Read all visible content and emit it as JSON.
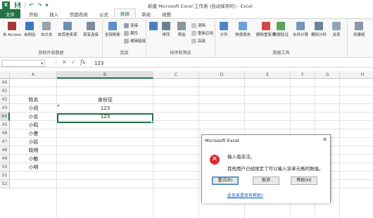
{
  "app": {
    "logo": "X",
    "title": "新建 Microsoft Excel 工作表 (自动保存的) - Excel"
  },
  "tabs": [
    "文件",
    "开始",
    "插入",
    "页面布局",
    "公式",
    "数据",
    "审阅",
    "视图"
  ],
  "active_tab": "数据",
  "ribbon": {
    "get_external": {
      "label": "获取外部数据",
      "buttons": [
        "自 Access",
        "自网站",
        "自文本",
        "自其他来源",
        "现有连接"
      ]
    },
    "connections": {
      "label": "连接",
      "big": "全部刷新",
      "small": [
        "连接",
        "属性",
        "编辑链接"
      ]
    },
    "sort_filter": {
      "label": "排序和筛选",
      "buttons": [
        "排序",
        "筛选"
      ],
      "small": [
        "清除",
        "重新应用",
        "高级"
      ]
    },
    "data_tools": {
      "label": "数据工具",
      "buttons": [
        "分列",
        "快速填充",
        "删除重复项",
        "数据验证",
        "合并计算",
        "模拟分析",
        "关系"
      ]
    },
    "outline": {
      "label": "创建组"
    }
  },
  "formula_bar": {
    "name_box": "",
    "cancel_icon": "✕",
    "enter_icon": "✓",
    "fx": "fx",
    "value": "123"
  },
  "columns": [
    "A",
    "B",
    "C",
    "D",
    "E",
    "F",
    "G",
    "H"
  ],
  "selected_column": "B",
  "rows": [
    "40",
    "41",
    "42",
    "43",
    "44",
    "45",
    "46",
    "47",
    "48",
    "49",
    "50",
    "51",
    "52"
  ],
  "selected_row": "44",
  "cells": [
    {
      "row": "42",
      "col": "A",
      "text": "姓名"
    },
    {
      "row": "42",
      "col": "B",
      "text": "身份证"
    },
    {
      "row": "43",
      "col": "A",
      "text": "小闵"
    },
    {
      "row": "43",
      "col": "B",
      "text": "123"
    },
    {
      "row": "44",
      "col": "A",
      "text": "小名"
    },
    {
      "row": "44",
      "col": "B",
      "text": "123"
    },
    {
      "row": "45",
      "col": "A",
      "text": "小鸣"
    },
    {
      "row": "46",
      "col": "A",
      "text": "小曼"
    },
    {
      "row": "47",
      "col": "A",
      "text": "小民"
    },
    {
      "row": "48",
      "col": "A",
      "text": "晓明"
    },
    {
      "row": "49",
      "col": "A",
      "text": "小敏"
    },
    {
      "row": "50",
      "col": "A",
      "text": "小明"
    }
  ],
  "dialog": {
    "title": "Microsoft Excel",
    "close": "✕",
    "icon": "error-icon",
    "message1": "输入值非法。",
    "message2": "其他用户已经限定了可以输入该单元格的数值。",
    "buttons": [
      "重试(R)",
      "取消",
      "帮助(H)"
    ],
    "link": "此信息是否有帮助?"
  },
  "colors": {
    "accent": "#217346",
    "error": "#e0282d",
    "link": "#0b57c4"
  }
}
